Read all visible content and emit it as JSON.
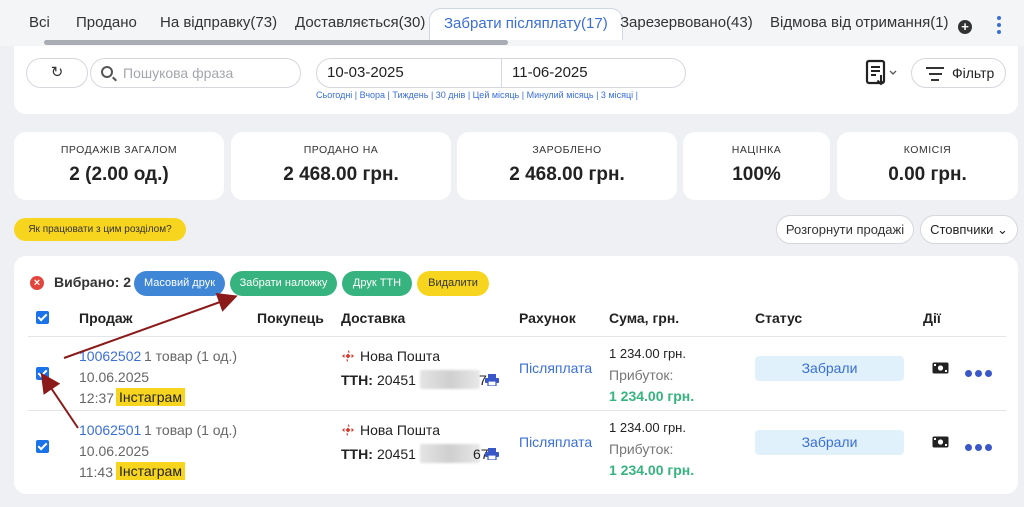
{
  "tabs": [
    {
      "label": "Всі"
    },
    {
      "label": "Продано"
    },
    {
      "label": "На відправку(73)"
    },
    {
      "label": "Доставляється(30)"
    },
    {
      "label": "Забрати післяплату(17)"
    },
    {
      "label": "Зарезервовано(43)"
    },
    {
      "label": "Відмова від отримання(1)"
    }
  ],
  "tabs_extra": {
    "plus_icon": "+"
  },
  "filters": {
    "refresh_icon": "↻",
    "search_placeholder": "Пошукова фраза",
    "date_from": "10-03-2025",
    "date_to": "11-06-2025",
    "quick_dates": "Сьогодні | Вчора | Тиждень | 30 днів | Цей місяць | Минулий місяць | 3 місяці |",
    "filter_label": "Фільтр"
  },
  "stats": [
    {
      "caption": "ПРОДАЖІВ ЗАГАЛОМ",
      "value": "2 (2.00 од.)"
    },
    {
      "caption": "ПРОДАНО НА",
      "value": "2 468.00 грн."
    },
    {
      "caption": "ЗАРОБЛЕНО",
      "value": "2 468.00 грн."
    },
    {
      "caption": "НАЦІНКА",
      "value": "100%"
    },
    {
      "caption": "КОМІСІЯ",
      "value": "0.00 грн."
    }
  ],
  "actions": {
    "help": "Як працювати з цим розділом?",
    "expand": "Розгорнути продажі",
    "columns": "Стовпчики ⌄"
  },
  "selection": {
    "close_icon": "×",
    "label": "Вибрано: 2",
    "mass_print": "Масовий друк",
    "collect_cod": "Забрати наложку",
    "print_ttn": "Друк ТТН",
    "delete": "Видалити"
  },
  "columns": {
    "sale": "Продаж",
    "buyer": "Покупець",
    "delivery": "Доставка",
    "invoice": "Рахунок",
    "sum": "Сума, грн.",
    "status": "Статус",
    "actions": "Дії"
  },
  "orders": [
    {
      "id": "10062502",
      "goods": "1 товар (1 од.)",
      "date": "10.06.2025",
      "time": "12:37",
      "source": "Інстаграм",
      "carrier": "Нова Пошта",
      "ttn_label": "ТТН:",
      "ttn_prefix": "20451",
      "ttn_suffix": "7",
      "invoice": "Післяплата",
      "sum": "1 234.00 грн.",
      "profit_label": "Прибуток:",
      "profit": "1 234.00 грн.",
      "status": "Забрали"
    },
    {
      "id": "10062501",
      "goods": "1 товар (1 од.)",
      "date": "10.06.2025",
      "time": "11:43",
      "source": "Інстаграм",
      "carrier": "Нова Пошта",
      "ttn_label": "ТТН:",
      "ttn_prefix": "20451",
      "ttn_suffix": "67",
      "invoice": "Післяплата",
      "sum": "1 234.00 грн.",
      "profit_label": "Прибуток:",
      "profit": "1 234.00 грн.",
      "status": "Забрали"
    }
  ],
  "colors": {
    "accent": "#3a6fd6",
    "green": "#36b37e",
    "yellow": "#f7d51e",
    "arrow": "#8b1a1a"
  }
}
